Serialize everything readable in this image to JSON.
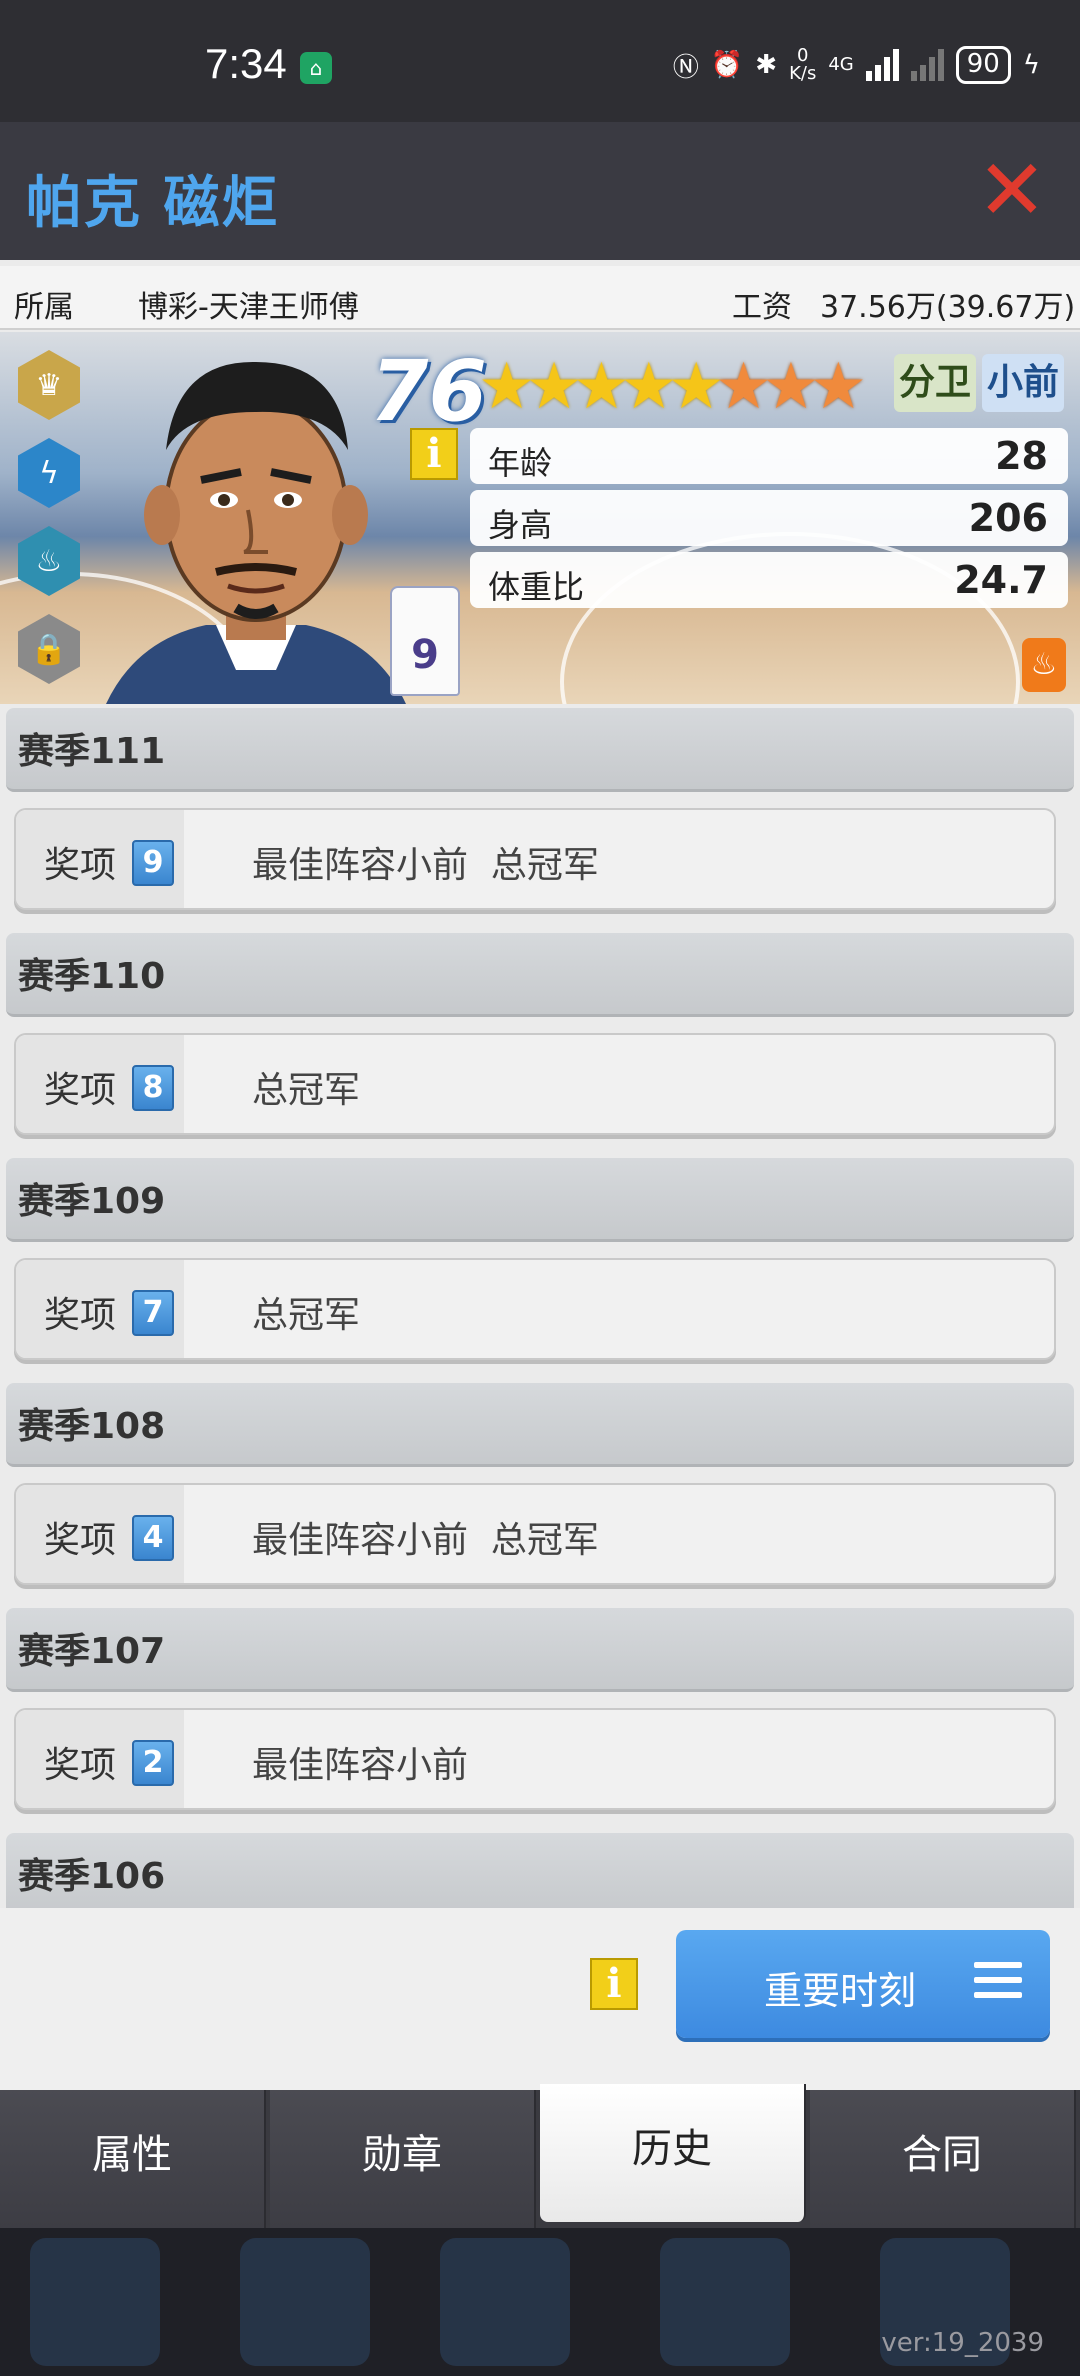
{
  "status_bar": {
    "time": "7:34",
    "net_speed_value": "0",
    "net_speed_unit": "K/s",
    "network_type": "4G",
    "battery": "90"
  },
  "header": {
    "title": "帕克 磁炬"
  },
  "player_info": {
    "team_label": "所属",
    "team_value": "博彩-天津王师傅",
    "salary_label": "工资",
    "salary_value": "37.56万(39.67万)"
  },
  "player_card": {
    "rating": "76",
    "stars_filled": "★★★★★",
    "stars_partial": "★★★",
    "position_primary": "分卫",
    "position_secondary": "小前",
    "jersey_number": "9",
    "info_icon": "i",
    "stats": [
      {
        "label": "年龄",
        "value": "28"
      },
      {
        "label": "身高",
        "value": "206"
      },
      {
        "label": "体重比",
        "value": "24.7"
      }
    ]
  },
  "history": [
    {
      "season": "赛季111",
      "award_label": "奖项",
      "award_count": "9",
      "awards": "最佳阵容小前  总冠军"
    },
    {
      "season": "赛季110",
      "award_label": "奖项",
      "award_count": "8",
      "awards": "总冠军"
    },
    {
      "season": "赛季109",
      "award_label": "奖项",
      "award_count": "7",
      "awards": "总冠军"
    },
    {
      "season": "赛季108",
      "award_label": "奖项",
      "award_count": "4",
      "awards": "最佳阵容小前  总冠军"
    },
    {
      "season": "赛季107",
      "award_label": "奖项",
      "award_count": "2",
      "awards": "最佳阵容小前"
    },
    {
      "season": "赛季106"
    }
  ],
  "actions": {
    "info_icon": "i",
    "moments_button": "重要时刻"
  },
  "tabs": [
    {
      "label": "属性"
    },
    {
      "label": "勋章"
    },
    {
      "label": "历史"
    },
    {
      "label": "合同"
    }
  ],
  "footer": {
    "version": "ver:19_2039"
  },
  "colors": {
    "title_blue": "#4fa6ee",
    "close_red": "#e03a2e",
    "button_blue": "#3d8ae0",
    "badge_blue": "#3a85cf"
  }
}
